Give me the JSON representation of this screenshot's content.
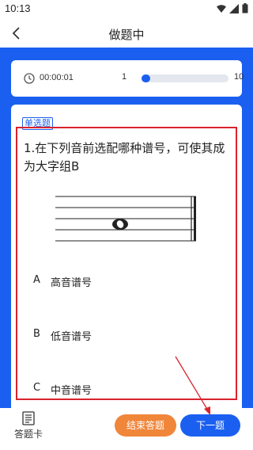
{
  "status_bar": {
    "time": "10:13"
  },
  "nav": {
    "title": "做题中"
  },
  "progress": {
    "timer": "00:00:01",
    "current": "1",
    "total": "10",
    "fraction": 0.1
  },
  "question": {
    "type": "单选题",
    "text": "1.在下列音前选配哪种谱号，可使其成为大字组B",
    "options": [
      {
        "letter": "A",
        "label": "高音谱号"
      },
      {
        "letter": "B",
        "label": "低音谱号"
      },
      {
        "letter": "C",
        "label": "中音谱号"
      }
    ]
  },
  "bottom": {
    "card_label": "答题卡",
    "end_label": "结束答题",
    "next_label": "下一题"
  },
  "colors": {
    "primary": "#1a5ff0",
    "orange": "#f0863a",
    "highlight": "#d9232e"
  }
}
